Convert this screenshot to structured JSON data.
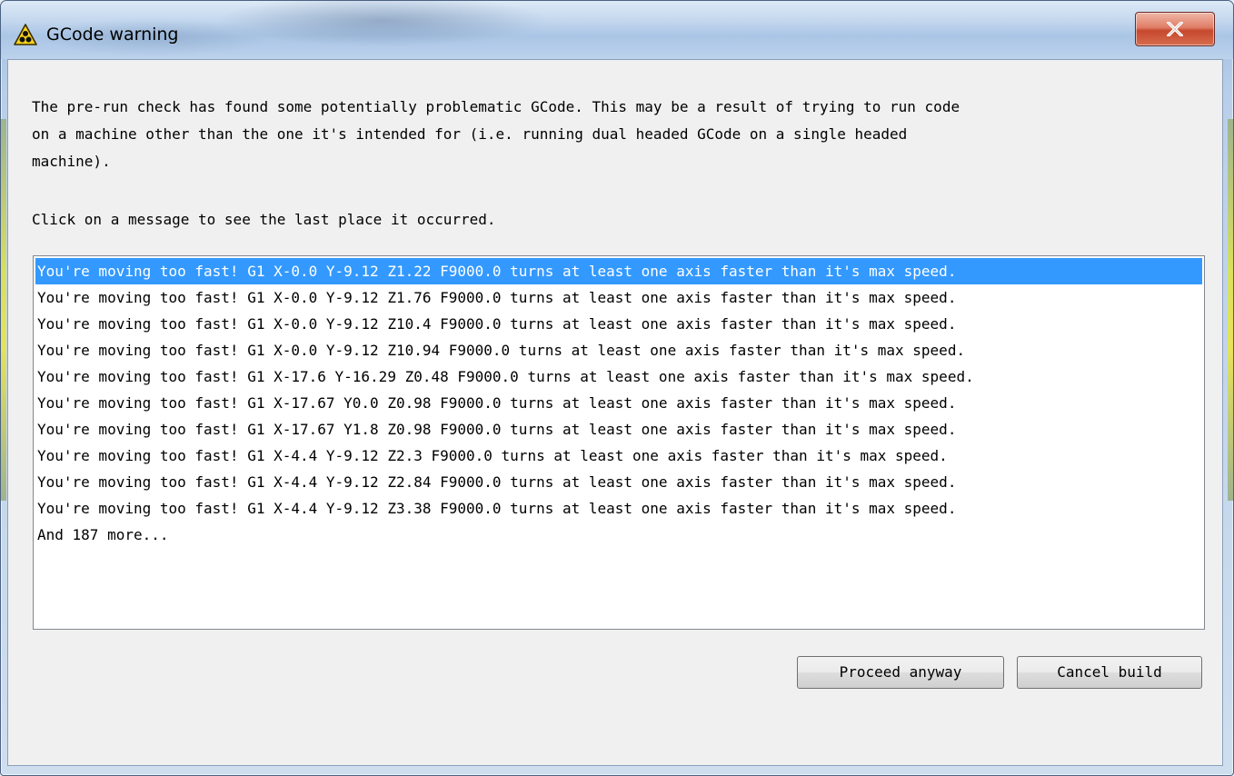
{
  "window": {
    "title": "GCode warning",
    "title_icon": "warning-icon",
    "close_icon": "close-icon"
  },
  "dialog": {
    "intro_lines": [
      "The pre-run check has found some potentially problematic GCode. This may be a result of trying to run code",
      "on a machine other than the one it's intended for (i.e. running dual headed GCode on a single headed",
      "machine)."
    ],
    "instruction": "Click on a message to see the last place it occurred.",
    "messages": [
      "You're moving too fast! G1 X-0.0 Y-9.12 Z1.22 F9000.0 turns at least one axis faster than it's max speed.",
      "You're moving too fast! G1 X-0.0 Y-9.12 Z1.76 F9000.0 turns at least one axis faster than it's max speed.",
      "You're moving too fast! G1 X-0.0 Y-9.12 Z10.4 F9000.0 turns at least one axis faster than it's max speed.",
      "You're moving too fast! G1 X-0.0 Y-9.12 Z10.94 F9000.0 turns at least one axis faster than it's max speed.",
      "You're moving too fast! G1 X-17.6 Y-16.29 Z0.48 F9000.0 turns at least one axis faster than it's max speed.",
      "You're moving too fast! G1 X-17.67 Y0.0 Z0.98 F9000.0 turns at least one axis faster than it's max speed.",
      "You're moving too fast! G1 X-17.67 Y1.8 Z0.98 F9000.0 turns at least one axis faster than it's max speed.",
      "You're moving too fast! G1 X-4.4 Y-9.12 Z2.3 F9000.0 turns at least one axis faster than it's max speed.",
      "You're moving too fast! G1 X-4.4 Y-9.12 Z2.84 F9000.0 turns at least one axis faster than it's max speed.",
      "You're moving too fast! G1 X-4.4 Y-9.12 Z3.38 F9000.0 turns at least one axis faster than it's max speed."
    ],
    "more_text": "And 187 more...",
    "selected_index": 0
  },
  "buttons": {
    "proceed_label": "Proceed anyway",
    "cancel_label": "Cancel build"
  },
  "colors": {
    "selection": "#3399ff",
    "list_bg": "#ffffff",
    "dialog_bg": "#f0f0f0",
    "close_button": "#c6482d"
  }
}
